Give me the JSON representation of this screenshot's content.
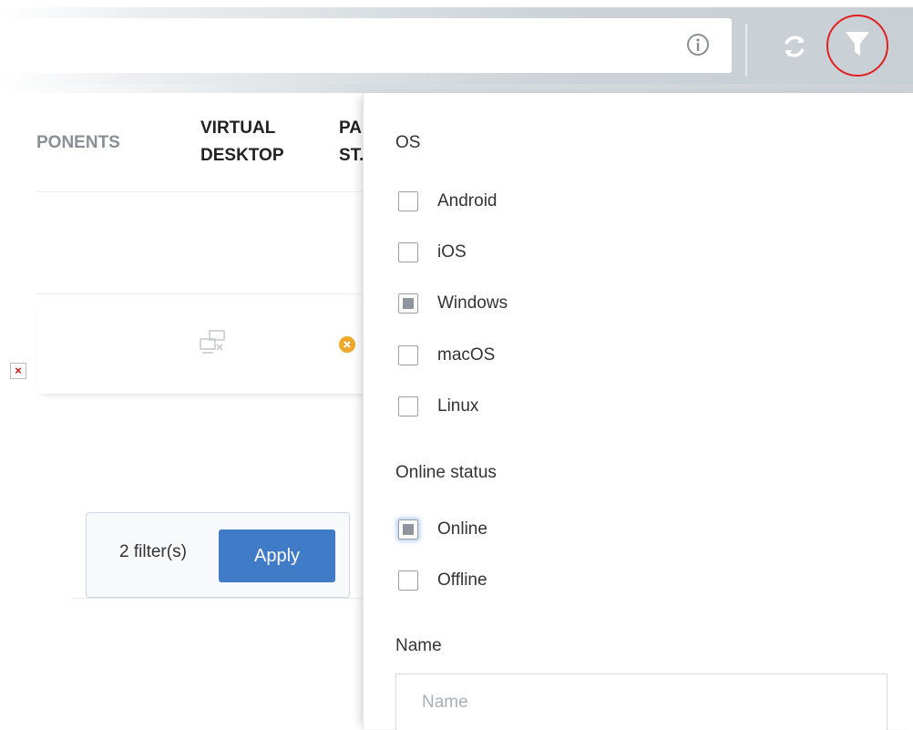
{
  "toolbar": {
    "search_value": "",
    "info_icon": "info-circle-icon",
    "refresh_icon": "refresh-icon",
    "filter_icon": "funnel-icon",
    "highlight_color": "#e02020"
  },
  "table": {
    "columns": [
      {
        "line1": "PONENTS",
        "line2": ""
      },
      {
        "line1": "VIRTUAL",
        "line2": "DESKTOP"
      },
      {
        "line1": "PA",
        "line2": "ST."
      }
    ],
    "row_icons": [
      "virtual-desktop-disconnected-icon",
      "status-warning-icon"
    ]
  },
  "apply_bar": {
    "count_label": "2 filter(s)",
    "apply_label": "Apply",
    "apply_color": "#3f7bc6"
  },
  "filter_panel": {
    "os": {
      "label": "OS",
      "options": [
        {
          "label": "Android",
          "checked": false
        },
        {
          "label": "iOS",
          "checked": false
        },
        {
          "label": "Windows",
          "checked": true
        },
        {
          "label": "macOS",
          "checked": false
        },
        {
          "label": "Linux",
          "checked": false
        }
      ]
    },
    "online_status": {
      "label": "Online status",
      "options": [
        {
          "label": "Online",
          "checked": true
        },
        {
          "label": "Offline",
          "checked": false
        }
      ]
    },
    "name": {
      "label": "Name",
      "placeholder": "Name",
      "value": ""
    }
  }
}
